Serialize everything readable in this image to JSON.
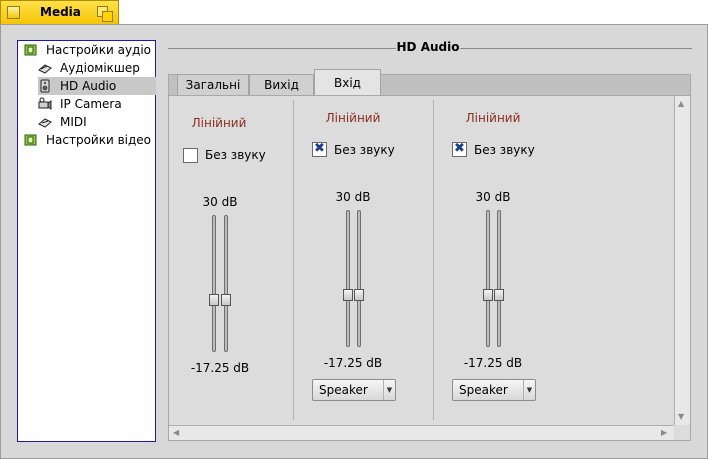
{
  "window": {
    "title": "Media"
  },
  "sidebar": {
    "items": [
      {
        "label": "Настройки аудіо",
        "icon": "audio-settings-icon"
      },
      {
        "label": "Аудіомікшер",
        "icon": "mixer-icon"
      },
      {
        "label": "HD Audio",
        "icon": "speaker-icon"
      },
      {
        "label": "IP Camera",
        "icon": "camera-icon"
      },
      {
        "label": "MIDI",
        "icon": "midi-icon"
      },
      {
        "label": "Настройки відео",
        "icon": "video-settings-icon"
      }
    ],
    "selected": "HD Audio"
  },
  "main": {
    "title": "HD Audio",
    "tabs": [
      {
        "label": "Загальні"
      },
      {
        "label": "Вихід"
      },
      {
        "label": "Вхід"
      }
    ],
    "active_tab": "Вхід",
    "channels": [
      {
        "label": "Лінійний",
        "mute_label": "Без звуку",
        "muted": false,
        "max": "30 dB",
        "min": "-17.25 dB",
        "source": null
      },
      {
        "label": "Лінійний",
        "mute_label": "Без звуку",
        "muted": true,
        "max": "30 dB",
        "min": "-17.25 dB",
        "source": "Speaker"
      },
      {
        "label": "Лінійний",
        "mute_label": "Без звуку",
        "muted": true,
        "max": "30 dB",
        "min": "-17.25 dB",
        "source": "Speaker"
      }
    ]
  },
  "colors": {
    "accent": "#f5c400",
    "channel_label": "#8b2d1e",
    "list_border": "#1b1bb4"
  }
}
